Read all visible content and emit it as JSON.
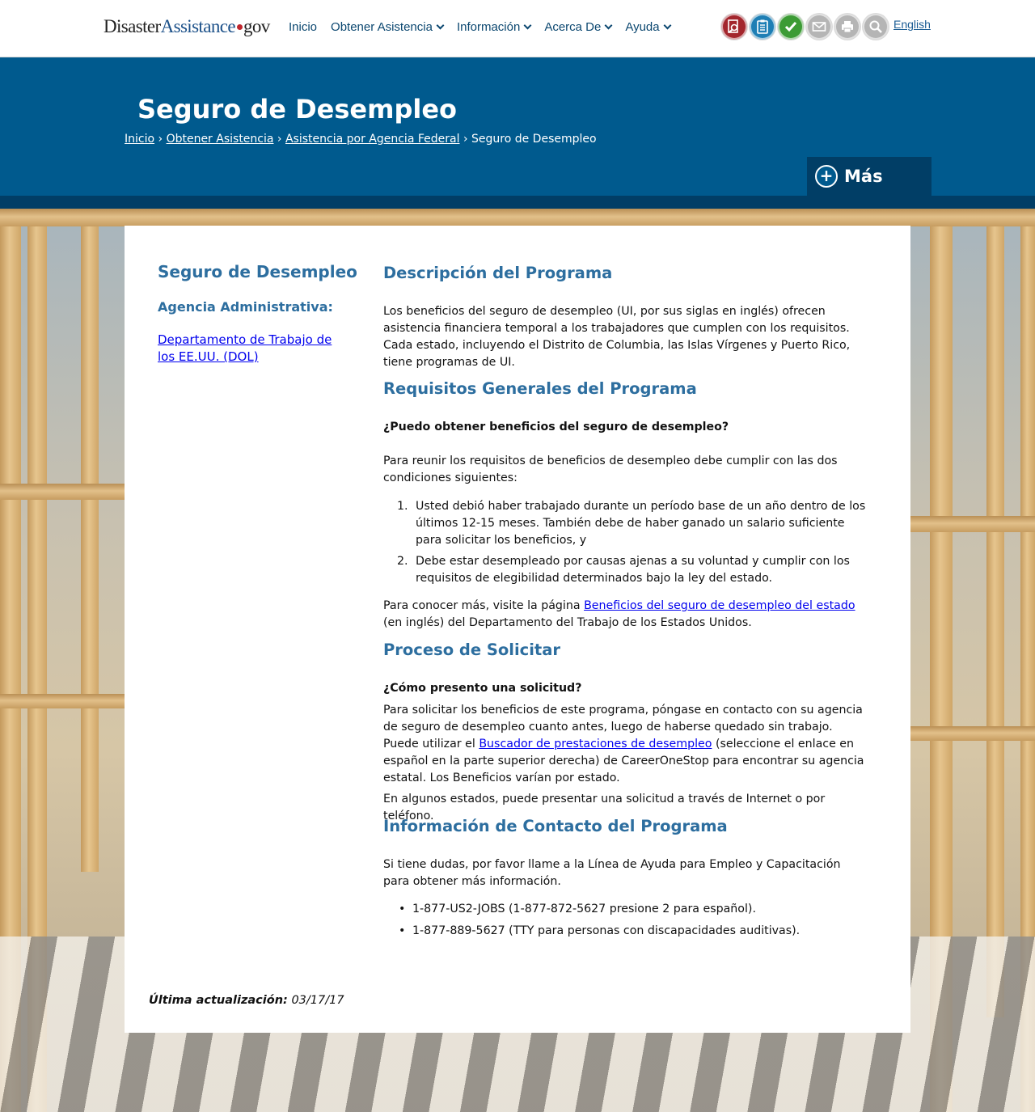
{
  "header": {
    "logo": {
      "part1": "Disaster",
      "part2": "Assistance",
      "part3": "gov"
    },
    "nav": [
      {
        "label": "Inicio",
        "dropdown": false
      },
      {
        "label": "Obtener Asistencia",
        "dropdown": true
      },
      {
        "label": "Información",
        "dropdown": true
      },
      {
        "label": "Acerca De",
        "dropdown": true
      },
      {
        "label": "Ayuda",
        "dropdown": true
      }
    ],
    "tools": [
      {
        "icon": "document-search-icon",
        "color": "#a3262d"
      },
      {
        "icon": "checklist-icon",
        "color": "#1e7fb5"
      },
      {
        "icon": "checkmark-icon",
        "color": "#3c9b35"
      },
      {
        "icon": "email-icon",
        "color": "#b5b5b5"
      },
      {
        "icon": "print-icon",
        "color": "#b5b5b5"
      },
      {
        "icon": "search-icon",
        "color": "#b5b5b5"
      }
    ],
    "language_link": "English"
  },
  "hero": {
    "title": "Seguro de Desempleo",
    "breadcrumb": [
      {
        "label": "Inicio",
        "link": true
      },
      {
        "label": "Obtener Asistencia",
        "link": true
      },
      {
        "label": "Asistencia por Agencia Federal",
        "link": true
      },
      {
        "label": "Seguro de Desempleo",
        "link": false
      }
    ],
    "separator": "›",
    "more_button": "Más",
    "more_icon": "+"
  },
  "sidebar": {
    "title": "Seguro de Desempleo",
    "agency_heading": "Agencia Administrativa:",
    "agency_link": "Departamento de Trabajo de los EE.UU. (DOL)"
  },
  "content": {
    "description": {
      "heading": "Descripción del Programa",
      "text": "Los beneficios del seguro de desempleo (UI, por sus siglas en inglés) ofrecen asistencia financiera temporal a los trabajadores que cumplen con los requisitos. Cada estado, incluyendo el Distrito de Columbia, las Islas Vírgenes y Puerto Rico, tiene programas de UI."
    },
    "requirements": {
      "heading": "Requisitos Generales del Programa",
      "question": "¿Puedo obtener beneficios del seguro de desempleo?",
      "intro": "Para reunir los requisitos de beneficios de desempleo debe cumplir con las dos condiciones siguientes:",
      "items": [
        "Usted debió haber trabajado durante un período base de un año dentro de los últimos 12-15 meses. También debe de haber ganado un salario suficiente para solicitar los beneficios, y",
        "Debe estar desempleado por causas ajenas a su voluntad y cumplir con los requisitos de elegibilidad determinados bajo la ley del estado."
      ],
      "more_before": "Para conocer más, visite la página ",
      "more_link": "Beneficios del seguro de desempleo del estado",
      "more_after": " (en inglés) del Departamento del Trabajo de los Estados Unidos."
    },
    "apply": {
      "heading": "Proceso de Solicitar",
      "question": "¿Cómo presento una solicitud?",
      "p1_before": "Para solicitar los beneficios de este programa, póngase en contacto con su agencia de seguro de desempleo cuanto antes, luego de haberse quedado sin trabajo. Puede utilizar el ",
      "p1_link": "Buscador de prestaciones de desempleo",
      "p1_after": " (seleccione el enlace en español en la parte superior derecha) de CareerOneStop para encontrar su agencia estatal. Los Beneficios varían por estado.",
      "p2": "En algunos estados, puede presentar una solicitud a través de Internet o por teléfono."
    },
    "contact": {
      "heading": "Información de Contacto del Programa",
      "intro": "Si tiene dudas, por favor llame a la Línea de Ayuda para Empleo y Capacitación para obtener más información.",
      "items": [
        "1-877-US2-JOBS (1-877-872-5627 presione 2 para español).",
        "1-877-889-5627 (TTY para personas con discapacidades auditivas)."
      ]
    }
  },
  "footer": {
    "updated_label": "Última actualización:",
    "updated_date": "03/17/17"
  },
  "colors": {
    "hero_blue": "#005a8e",
    "hero_dark": "#013e66",
    "heading_blue": "#2d6e9f",
    "link": "#0000ee"
  }
}
